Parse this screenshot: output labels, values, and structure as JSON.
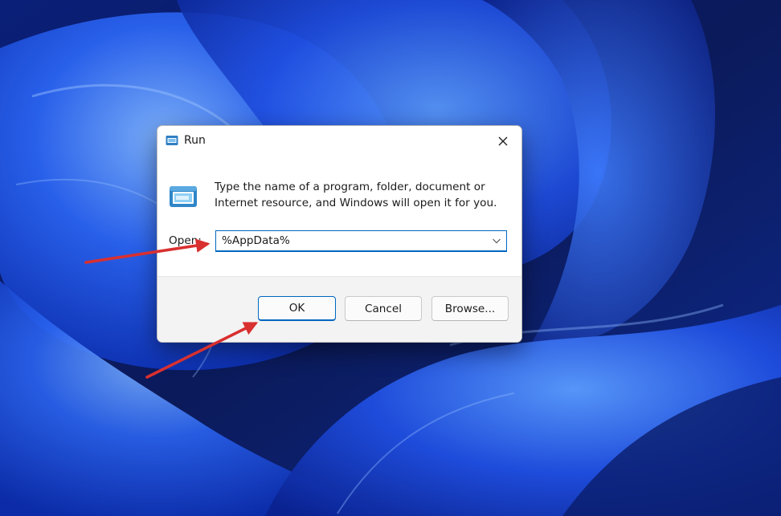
{
  "dialog": {
    "title": "Run",
    "description": "Type the name of a program, folder, document or Internet resource, and Windows will open it for you.",
    "open_label": "Open:",
    "open_value": "%AppData%",
    "buttons": {
      "ok": "OK",
      "cancel": "Cancel",
      "browse": "Browse..."
    }
  },
  "icons": {
    "title": "run-app-icon",
    "content": "run-app-large-icon",
    "close": "close-icon",
    "dropdown": "chevron-down-icon"
  },
  "colors": {
    "accent": "#0067c0",
    "annotation_arrow": "#d93030"
  }
}
